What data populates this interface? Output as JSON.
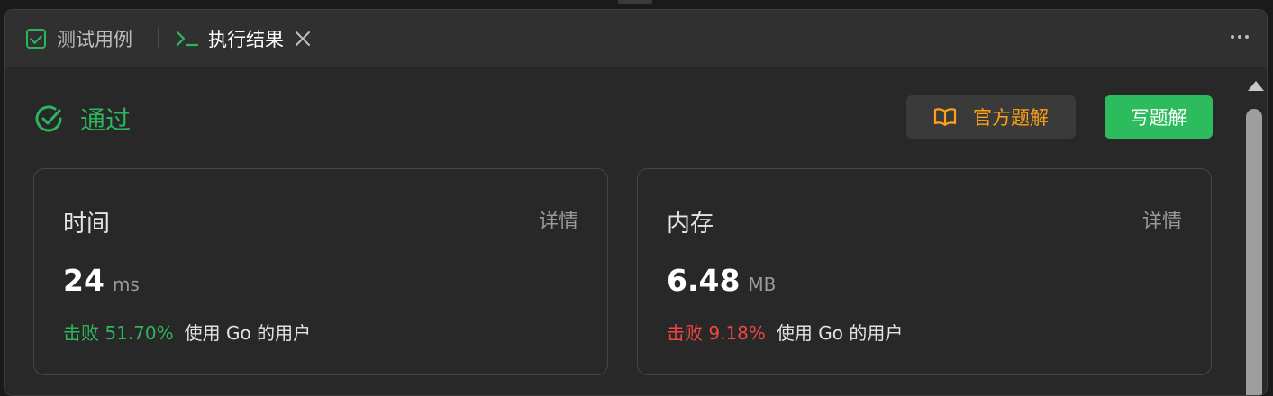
{
  "tabs": {
    "testcase_label": "测试用例",
    "result_label": "执行结果"
  },
  "status": {
    "label": "通过",
    "color": "#2db55d"
  },
  "buttons": {
    "official_solution": "官方题解",
    "write_solution": "写题解"
  },
  "time_card": {
    "title": "时间",
    "detail": "详情",
    "value": "24",
    "unit": "ms",
    "beat_label": "击败 51.70%",
    "beat_suffix": "使用 Go 的用户"
  },
  "memory_card": {
    "title": "内存",
    "detail": "详情",
    "value": "6.48",
    "unit": "MB",
    "beat_label": "击败 9.18%",
    "beat_suffix": "使用 Go 的用户"
  },
  "colors": {
    "accent_green": "#2db55d",
    "accent_orange": "#ffa116",
    "accent_red": "#ef4743"
  },
  "icons": [
    "check-box-icon",
    "terminal-icon",
    "close-icon",
    "more-icon",
    "check-circle-icon",
    "book-icon"
  ]
}
